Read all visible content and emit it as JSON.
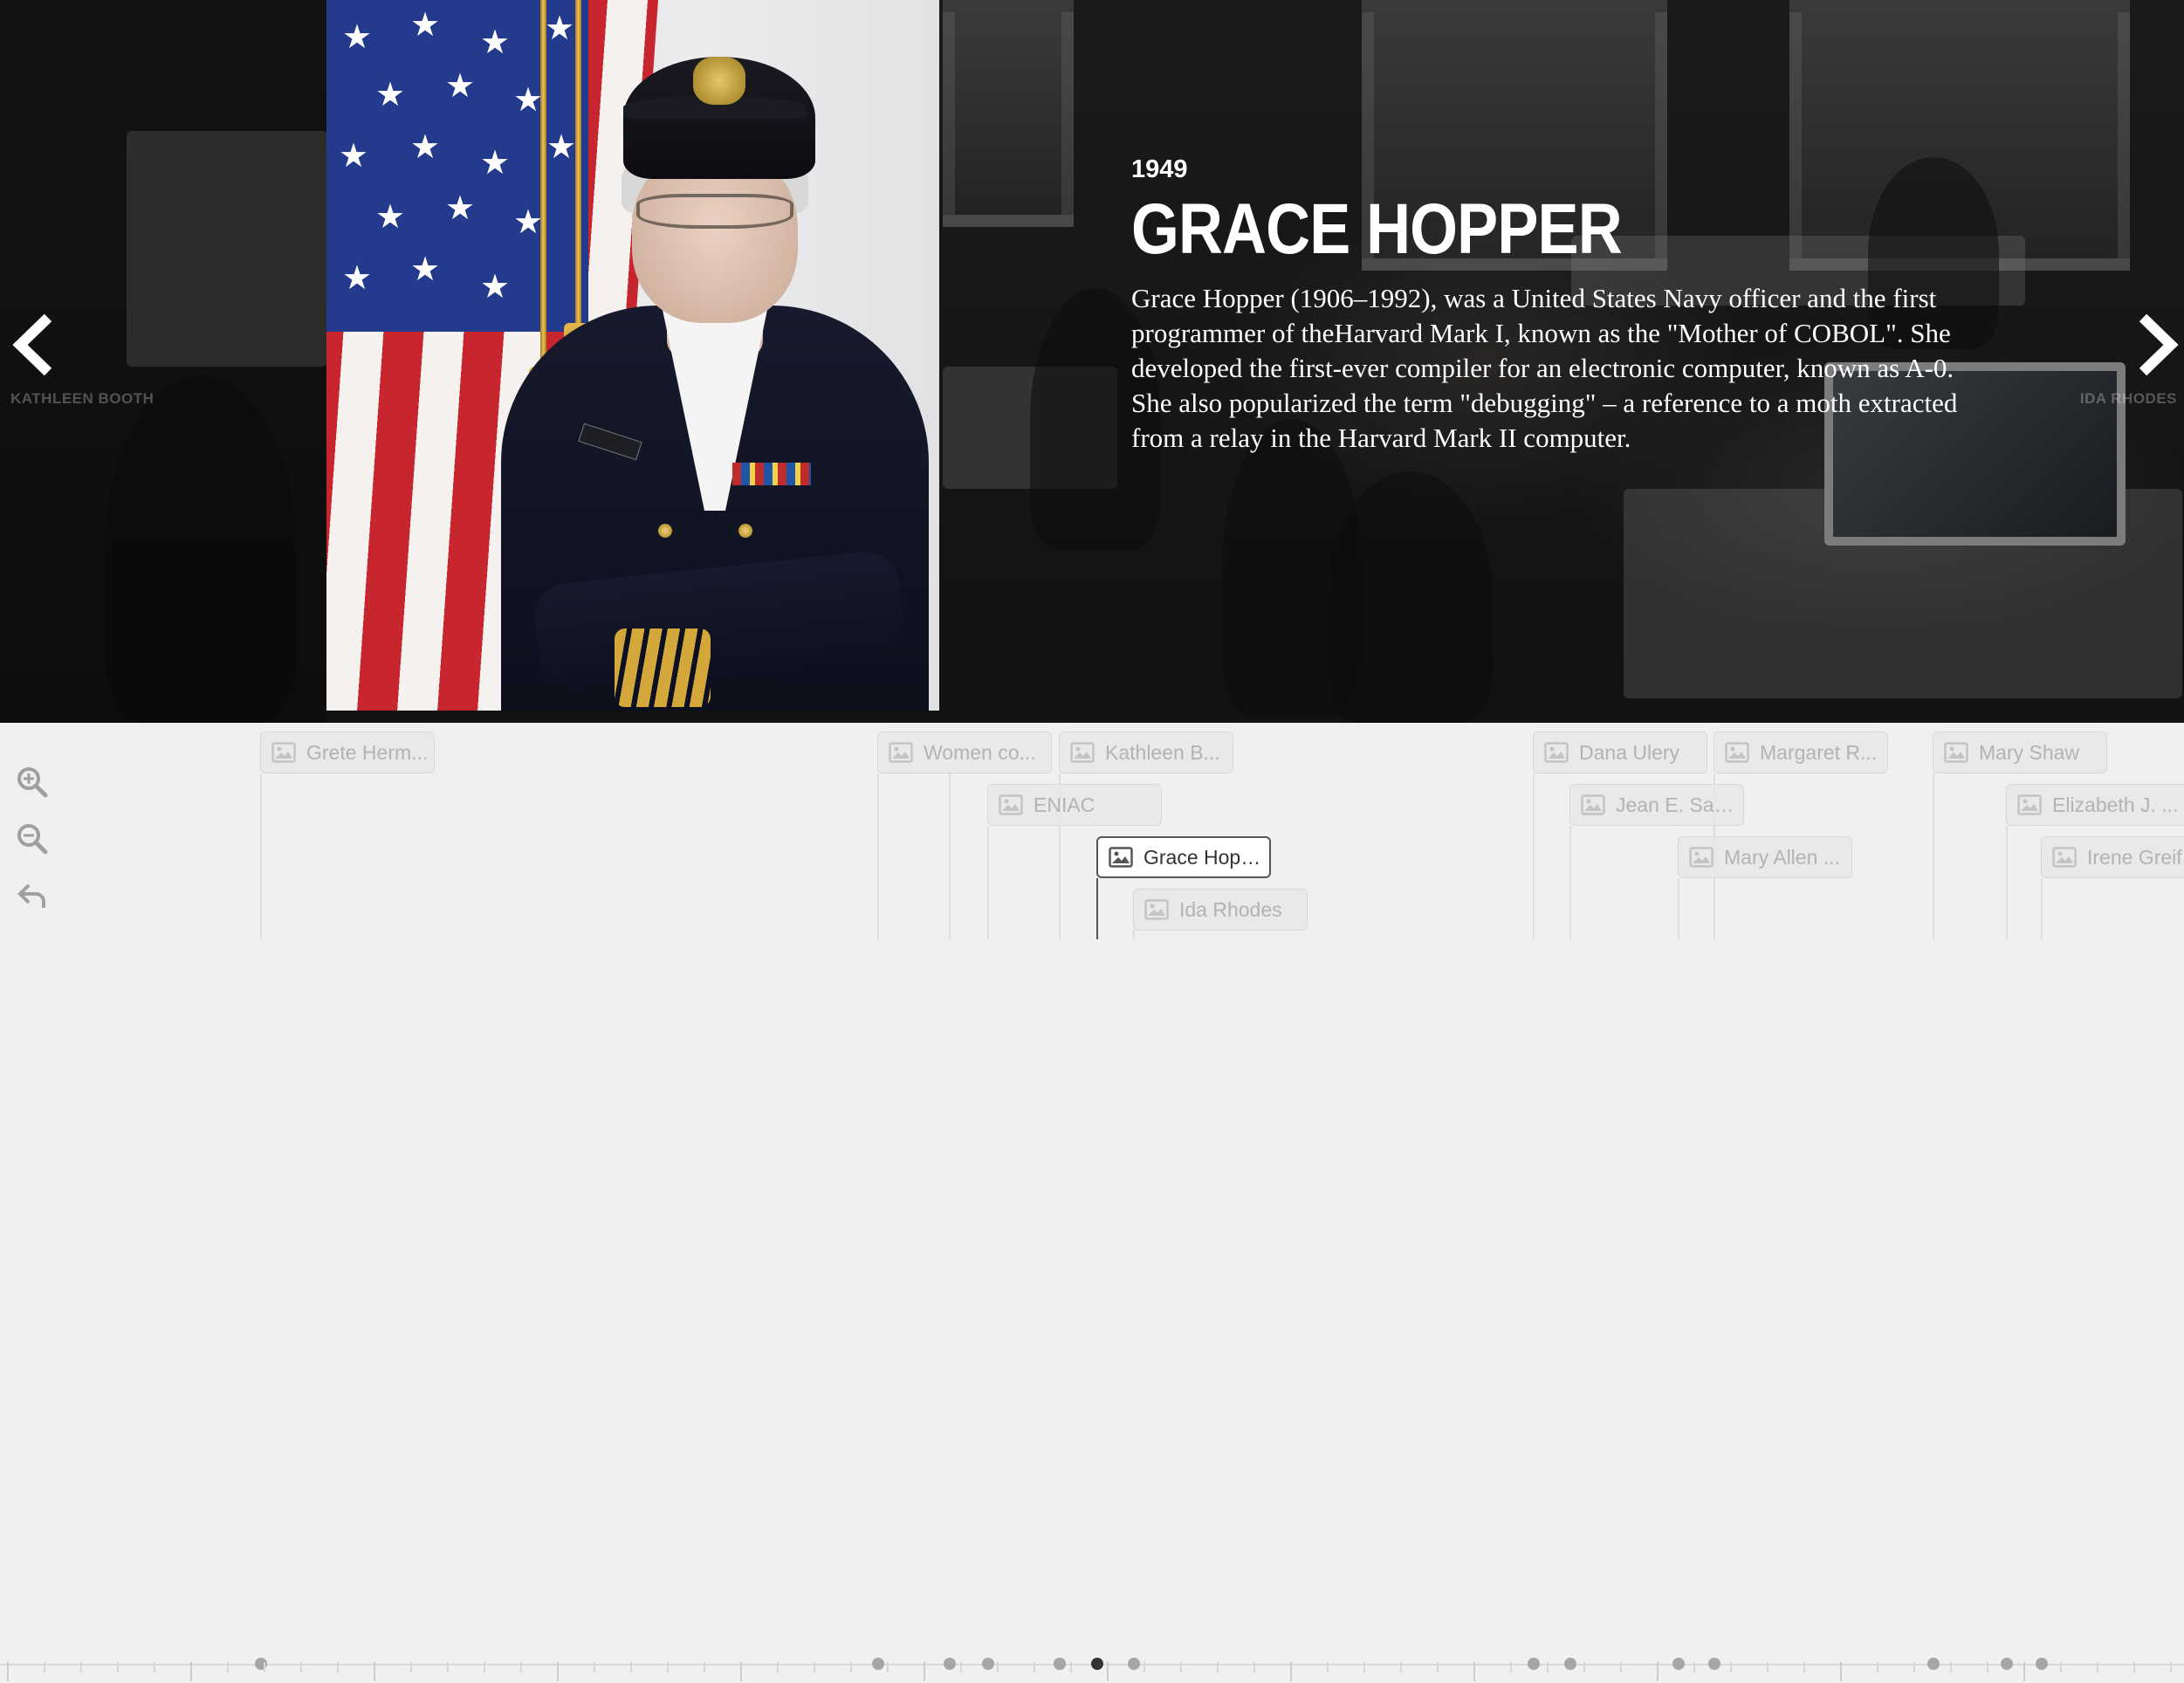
{
  "slide": {
    "year": "1949",
    "title": "GRACE HOPPER",
    "description": "Grace Hopper (1906–1992), was a United States Navy officer and the first programmer of theHarvard Mark I, known as the \"Mother of COBOL\". She developed the first-ever compiler for an electronic computer, known as A-0. She also popularized the term \"debugging\" – a reference to a moth extracted from a relay in the Harvard Mark II computer.",
    "prev_label": "KATHLEEN BOOTH",
    "next_label": "IDA RHODES"
  },
  "nav": {
    "prev_icon": "chevron-left-icon",
    "next_icon": "chevron-right-icon"
  },
  "zoom": {
    "zoom_in_icon": "zoom-in-icon",
    "zoom_out_icon": "zoom-out-icon",
    "back_icon": "undo-arrow-icon"
  },
  "markers": [
    {
      "label": "Grete Herm...",
      "active": false
    },
    {
      "label": "Women co...",
      "active": false
    },
    {
      "label": "Kathleen B...",
      "active": false
    },
    {
      "label": "ENIAC",
      "active": false
    },
    {
      "label": "Grace Hopper",
      "active": true
    },
    {
      "label": "Ida Rhodes",
      "active": false
    },
    {
      "label": "Dana Ulery",
      "active": false
    },
    {
      "label": "Margaret R...",
      "active": false
    },
    {
      "label": "Jean E. Sam...",
      "active": false
    },
    {
      "label": "Mary Allen ...",
      "active": false
    },
    {
      "label": "Mary Shaw",
      "active": false
    },
    {
      "label": "Elizabeth J. ...",
      "active": false
    },
    {
      "label": "Irene Greif",
      "active": false
    }
  ],
  "colors": {
    "active_border": "#555555",
    "marker_text": "#b3b3b3",
    "active_text": "#333333",
    "timeline_bg": "#f0f0f0"
  }
}
